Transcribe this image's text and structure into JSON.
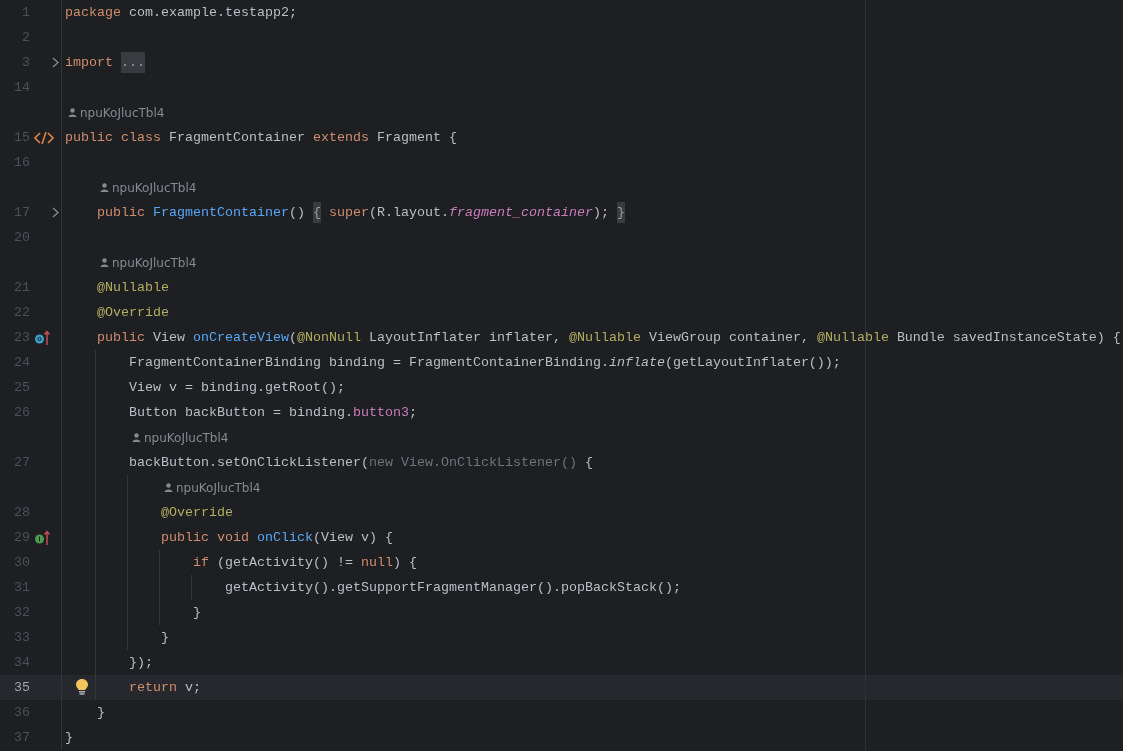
{
  "editor": {
    "lines": [
      {
        "number": "1",
        "current": false,
        "tokens": [
          {
            "kind": "kw",
            "text": "package"
          },
          {
            "kind": "plain",
            "text": " com.example.testapp2;"
          }
        ]
      },
      {
        "number": "2",
        "current": false
      },
      {
        "number": "3",
        "current": false,
        "gutter_icon": {
          "kind": "fold"
        },
        "tokens": [
          {
            "kind": "kw",
            "text": "import "
          },
          {
            "kind": "folded",
            "text": "..."
          }
        ]
      },
      {
        "number": "14",
        "current": false
      },
      {
        "author": "npuKoJlucTbl4"
      },
      {
        "number": "15",
        "current": false,
        "gutter_icon": {
          "kind": "class"
        },
        "tokens": [
          {
            "kind": "kw",
            "text": "public class "
          },
          {
            "kind": "plain",
            "text": "FragmentContainer "
          },
          {
            "kind": "kw",
            "text": "extends "
          },
          {
            "kind": "plain",
            "text": "Fragment {"
          }
        ],
        "children": [
          {
            "number": "16",
            "current": false
          },
          {
            "author": "npuKoJlucTbl4"
          },
          {
            "number": "17",
            "current": false,
            "gutter_icon": {
              "kind": "fold"
            },
            "tokens": [
              {
                "kind": "kw",
                "text": "public "
              },
              {
                "kind": "fn",
                "text": "FragmentContainer"
              },
              {
                "kind": "plain",
                "text": "() "
              },
              {
                "kind": "folded",
                "text": "{"
              },
              {
                "kind": "kw",
                "text": " super"
              },
              {
                "kind": "plain",
                "text": "(R.layout."
              },
              {
                "kind": "static",
                "text": "fragment_container"
              },
              {
                "kind": "plain",
                "text": "); "
              },
              {
                "kind": "folded",
                "text": "}"
              }
            ]
          },
          {
            "number": "20",
            "current": false
          },
          {
            "author": "npuKoJlucTbl4"
          },
          {
            "number": "21",
            "current": false,
            "tokens": [
              {
                "kind": "ann",
                "text": "@Nullable"
              }
            ]
          },
          {
            "number": "22",
            "current": false,
            "tokens": [
              {
                "kind": "ann",
                "text": "@Override"
              }
            ]
          },
          {
            "number": "23",
            "current": false,
            "gutter_icon": {
              "kind": "override"
            },
            "tokens": [
              {
                "kind": "kw",
                "text": "public "
              },
              {
                "kind": "plain",
                "text": "View "
              },
              {
                "kind": "fn",
                "text": "onCreateView"
              },
              {
                "kind": "plain",
                "text": "("
              },
              {
                "kind": "ann",
                "text": "@NonNull "
              },
              {
                "kind": "plain",
                "text": "LayoutInflater inflater, "
              },
              {
                "kind": "ann",
                "text": "@Nullable "
              },
              {
                "kind": "plain",
                "text": "ViewGroup container, "
              },
              {
                "kind": "ann",
                "text": "@Nullable "
              },
              {
                "kind": "plain",
                "text": "Bundle savedInstanceState) {"
              }
            ],
            "children": [
              {
                "number": "24",
                "current": false,
                "tokens": [
                  {
                    "kind": "plain",
                    "text": "FragmentContainerBinding binding = FragmentContainerBinding."
                  },
                  {
                    "kind": "italic",
                    "text": "inflate"
                  },
                  {
                    "kind": "plain",
                    "text": "(getLayoutInflater());"
                  }
                ]
              },
              {
                "number": "25",
                "current": false,
                "tokens": [
                  {
                    "kind": "plain",
                    "text": "View v = binding.getRoot();"
                  }
                ]
              },
              {
                "number": "26",
                "current": false,
                "tokens": [
                  {
                    "kind": "plain",
                    "text": "Button backButton = binding."
                  },
                  {
                    "kind": "field",
                    "text": "button3"
                  },
                  {
                    "kind": "plain",
                    "text": ";"
                  }
                ]
              },
              {
                "author": "npuKoJlucTbl4"
              },
              {
                "number": "27",
                "current": false,
                "tokens": [
                  {
                    "kind": "plain",
                    "text": "backButton.setOnClickListener("
                  },
                  {
                    "kind": "dim",
                    "text": "new View.OnClickListener()"
                  },
                  {
                    "kind": "plain",
                    "text": " {"
                  }
                ],
                "children": [
                  {
                    "author": "npuKoJlucTbl4"
                  },
                  {
                    "number": "28",
                    "current": false,
                    "tokens": [
                      {
                        "kind": "ann",
                        "text": "@Override"
                      }
                    ]
                  },
                  {
                    "number": "29",
                    "current": false,
                    "gutter_icon": {
                      "kind": "implement"
                    },
                    "tokens": [
                      {
                        "kind": "kw",
                        "text": "public void "
                      },
                      {
                        "kind": "fn",
                        "text": "onClick"
                      },
                      {
                        "kind": "plain",
                        "text": "(View v) {"
                      }
                    ],
                    "children": [
                      {
                        "number": "30",
                        "current": false,
                        "tokens": [
                          {
                            "kind": "kw",
                            "text": "if "
                          },
                          {
                            "kind": "plain",
                            "text": "(getActivity() != "
                          },
                          {
                            "kind": "kw",
                            "text": "null"
                          },
                          {
                            "kind": "plain",
                            "text": ") {"
                          }
                        ],
                        "children": [
                          {
                            "number": "31",
                            "current": false,
                            "tokens": [
                              {
                                "kind": "plain",
                                "text": "getActivity().getSupportFragmentManager().popBackStack();"
                              }
                            ]
                          }
                        ]
                      },
                      {
                        "number": "32",
                        "current": false,
                        "tokens": [
                          {
                            "kind": "plain",
                            "text": "}"
                          }
                        ]
                      }
                    ]
                  },
                  {
                    "number": "33",
                    "current": false,
                    "tokens": [
                      {
                        "kind": "plain",
                        "text": "}"
                      }
                    ]
                  }
                ]
              },
              {
                "number": "34",
                "current": false,
                "tokens": [
                  {
                    "kind": "plain",
                    "text": "});"
                  }
                ]
              },
              {
                "number": "35",
                "current": true,
                "gutter_icon": {
                  "kind": "bulb"
                },
                "tokens": [
                  {
                    "kind": "kw",
                    "text": "return "
                  },
                  {
                    "kind": "plain",
                    "text": "v;"
                  }
                ]
              }
            ]
          },
          {
            "number": "36",
            "current": false,
            "tokens": [
              {
                "kind": "plain",
                "text": "}"
              }
            ]
          }
        ]
      },
      {
        "number": "37",
        "current": false,
        "tokens": [
          {
            "kind": "plain",
            "text": "}"
          }
        ]
      }
    ]
  }
}
